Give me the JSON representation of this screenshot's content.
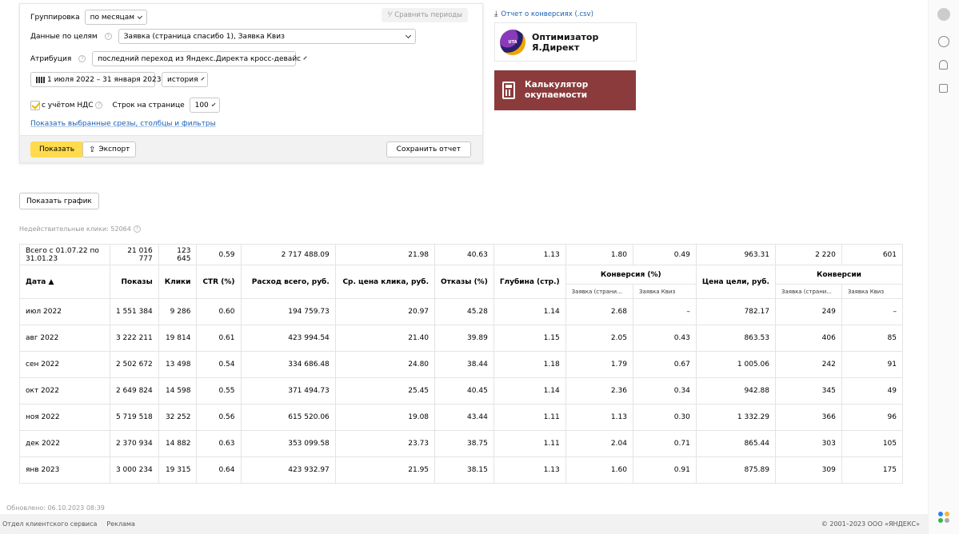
{
  "filters": {
    "grouping_label": "Группировка",
    "grouping_value": "по месяцам",
    "compare_label": "Сравнить периоды",
    "goals_label": "Данные по целям",
    "goals_value": "Заявка (страница спасибо 1), Заявка Квиз",
    "attribution_label": "Атрибуция",
    "attribution_value": "последний переход из Яндекс.Директа кросс-девайс",
    "date_range": "1 июля 2022 – 31 января 2023",
    "history_value": "история",
    "vat_label": "с учётом НДС",
    "rows_label": "Строк на странице",
    "rows_value": "100",
    "show_slices_link": "Показать выбранные срезы, столбцы и фильтры",
    "show_button": "Показать",
    "export_button": "Экспорт",
    "save_button": "Сохранить отчет"
  },
  "promo": {
    "csv_link": "Отчет о конверсиях (.csv)",
    "optimizer_logo": "UTA",
    "optimizer_line1": "Оптимизатор",
    "optimizer_line2": "Я.Директ",
    "calc_line1": "Калькулятор",
    "calc_line2": "окупаемости"
  },
  "show_chart_button": "Показать график",
  "invalid_clicks": "Недействительные клики: 52064",
  "table": {
    "totals": [
      "Всего с 01.07.22 по 31.01.23",
      "21 016 777",
      "123 645",
      "0.59",
      "2 717 488.09",
      "21.98",
      "40.63",
      "1.13",
      "1.80",
      "0.49",
      "963.31",
      "2 220",
      "601"
    ],
    "headers": [
      "Дата ▲",
      "Показы",
      "Клики",
      "CTR (%)",
      "Расход всего, руб.",
      "Ср. цена клика, руб.",
      "Отказы (%)",
      "Глубина (стр.)",
      "Конверсия (%)",
      "Цена цели, руб.",
      "Конверсии"
    ],
    "subheaders": [
      "Заявка (страни...",
      "Заявка Квиз",
      "Заявка (страни...",
      "Заявка Квиз"
    ],
    "rows": [
      [
        "июл 2022",
        "1 551 384",
        "9 286",
        "0.60",
        "194 759.73",
        "20.97",
        "45.28",
        "1.14",
        "2.68",
        "–",
        "782.17",
        "249",
        "–"
      ],
      [
        "авг 2022",
        "3 222 211",
        "19 814",
        "0.61",
        "423 994.54",
        "21.40",
        "39.89",
        "1.15",
        "2.05",
        "0.43",
        "863.53",
        "406",
        "85"
      ],
      [
        "сен 2022",
        "2 502 672",
        "13 498",
        "0.54",
        "334 686.48",
        "24.80",
        "38.44",
        "1.18",
        "1.79",
        "0.67",
        "1 005.06",
        "242",
        "91"
      ],
      [
        "окт 2022",
        "2 649 824",
        "14 598",
        "0.55",
        "371 494.73",
        "25.45",
        "40.45",
        "1.14",
        "2.36",
        "0.34",
        "942.88",
        "345",
        "49"
      ],
      [
        "ноя 2022",
        "5 719 518",
        "32 252",
        "0.56",
        "615 520.06",
        "19.08",
        "43.44",
        "1.11",
        "1.13",
        "0.30",
        "1 332.29",
        "366",
        "96"
      ],
      [
        "дек 2022",
        "2 370 934",
        "14 882",
        "0.63",
        "353 099.58",
        "23.73",
        "38.75",
        "1.11",
        "2.04",
        "0.71",
        "865.44",
        "303",
        "105"
      ],
      [
        "янв 2023",
        "3 000 234",
        "19 315",
        "0.64",
        "423 932.97",
        "21.95",
        "38.15",
        "1.13",
        "1.60",
        "0.91",
        "875.89",
        "309",
        "175"
      ]
    ]
  },
  "updated": "Обновлено: 06.10.2023 08:39",
  "footer": {
    "support": "Отдел клиентского сервиса",
    "ads": "Реклама",
    "copyright": "© 2001–2023 ООО «ЯНДЕКС»"
  },
  "colors": {
    "accent_yellow": "#ffdb4d",
    "calc_bg": "#8b3b3b",
    "link_blue": "#1a5fb4"
  }
}
